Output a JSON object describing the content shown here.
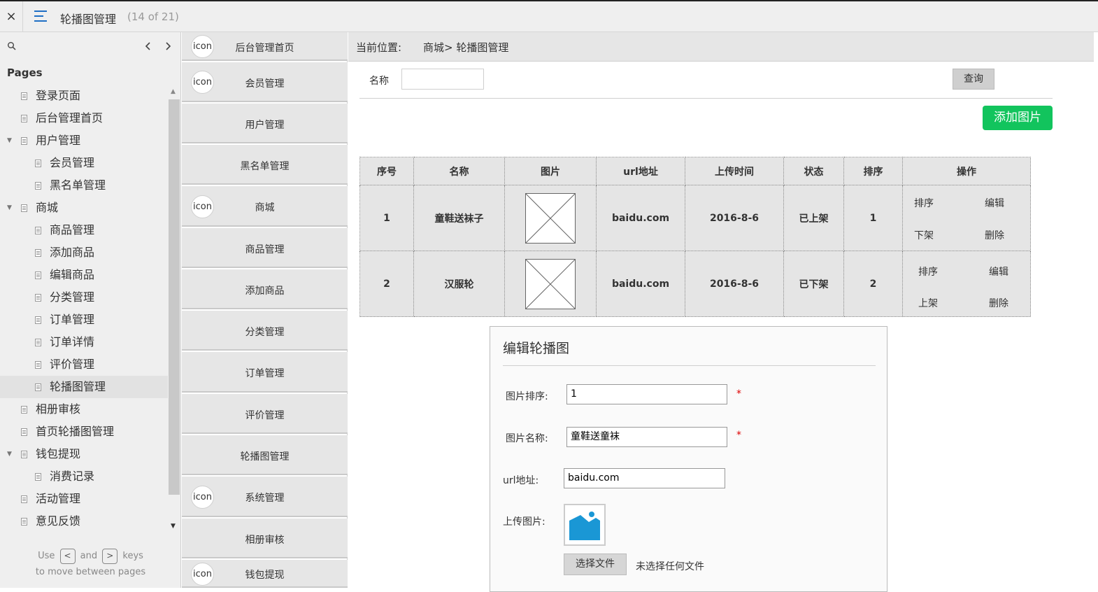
{
  "topbar": {
    "close": "×",
    "title": "轮播图管理",
    "count": "(14 of 21)"
  },
  "sidebar": {
    "heading": "Pages",
    "items": [
      {
        "label": "登录页面",
        "level": 1,
        "caret": false
      },
      {
        "label": "后台管理首页",
        "level": 1,
        "caret": false
      },
      {
        "label": "用户管理",
        "level": 1,
        "caret": true
      },
      {
        "label": "会员管理",
        "level": 2,
        "caret": false
      },
      {
        "label": "黑名单管理",
        "level": 2,
        "caret": false
      },
      {
        "label": "商城",
        "level": 1,
        "caret": true
      },
      {
        "label": "商品管理",
        "level": 2,
        "caret": false
      },
      {
        "label": "添加商品",
        "level": 2,
        "caret": false
      },
      {
        "label": "编辑商品",
        "level": 2,
        "caret": false
      },
      {
        "label": "分类管理",
        "level": 2,
        "caret": false
      },
      {
        "label": "订单管理",
        "level": 2,
        "caret": false
      },
      {
        "label": "订单详情",
        "level": 2,
        "caret": false
      },
      {
        "label": "评价管理",
        "level": 2,
        "caret": false
      },
      {
        "label": "轮播图管理",
        "level": 2,
        "caret": false,
        "selected": true
      },
      {
        "label": "相册审核",
        "level": 1,
        "caret": false
      },
      {
        "label": "首页轮播图管理",
        "level": 1,
        "caret": false
      },
      {
        "label": "钱包提现",
        "level": 1,
        "caret": true
      },
      {
        "label": "消费记录",
        "level": 2,
        "caret": false
      },
      {
        "label": "活动管理",
        "level": 1,
        "caret": false
      },
      {
        "label": "意见反馈",
        "level": 1,
        "caret": false
      }
    ],
    "hint_use": "Use",
    "hint_and": "and",
    "hint_keys": "keys",
    "hint_line2": "to move between pages",
    "key_prev": "<",
    "key_next": ">"
  },
  "leftnav": {
    "icon_text": "icon",
    "items": [
      {
        "label": "后台管理首页",
        "icon": true
      },
      {
        "label": "会员管理",
        "icon": true
      },
      {
        "label": "用户管理",
        "icon": false
      },
      {
        "label": "黑名单管理",
        "icon": false
      },
      {
        "label": "商城",
        "icon": true
      },
      {
        "label": "商品管理",
        "icon": false
      },
      {
        "label": "添加商品",
        "icon": false
      },
      {
        "label": "分类管理",
        "icon": false
      },
      {
        "label": "订单管理",
        "icon": false
      },
      {
        "label": "评价管理",
        "icon": false
      },
      {
        "label": "轮播图管理",
        "icon": false
      },
      {
        "label": "系统管理",
        "icon": true
      },
      {
        "label": "相册审核",
        "icon": false
      },
      {
        "label": "钱包提现",
        "icon": true
      }
    ]
  },
  "main": {
    "breadcrumb_label": "当前位置:",
    "breadcrumb_path": "商城> 轮播图管理",
    "filter_label": "名称",
    "filter_value": "",
    "query_button": "查询",
    "add_button": "添加图片",
    "table": {
      "headers": [
        "序号",
        "名称",
        "图片",
        "url地址",
        "上传时间",
        "状态",
        "排序",
        "操作"
      ],
      "rows": [
        {
          "id": "1",
          "name": "童鞋送袜子",
          "url": "baidu.com",
          "time": "2016-8-6",
          "status": "已上架",
          "order": "1",
          "ops": [
            "排序",
            "编辑",
            "下架",
            "删除"
          ]
        },
        {
          "id": "2",
          "name": "汉服轮",
          "url": "baidu.com",
          "time": "2016-8-6",
          "status": "已下架",
          "order": "2",
          "ops": [
            "排序",
            "编辑",
            "上架",
            "删除"
          ]
        }
      ]
    }
  },
  "dialog": {
    "title": "编辑轮播图",
    "sort_label": "图片排序:",
    "sort_value": "1",
    "name_label": "图片名称:",
    "name_value": "童鞋送童袜",
    "url_label": "url地址:",
    "url_value": "baidu.com",
    "upload_label": "上传图片:",
    "required_mark": "*",
    "choose_button": "选择文件",
    "no_file": "未选择任何文件"
  },
  "colors": {
    "accent_blue": "#1f6fc5",
    "add_green": "#12c45d",
    "required_red": "#dd0000",
    "image_blue": "#1a97d5"
  }
}
